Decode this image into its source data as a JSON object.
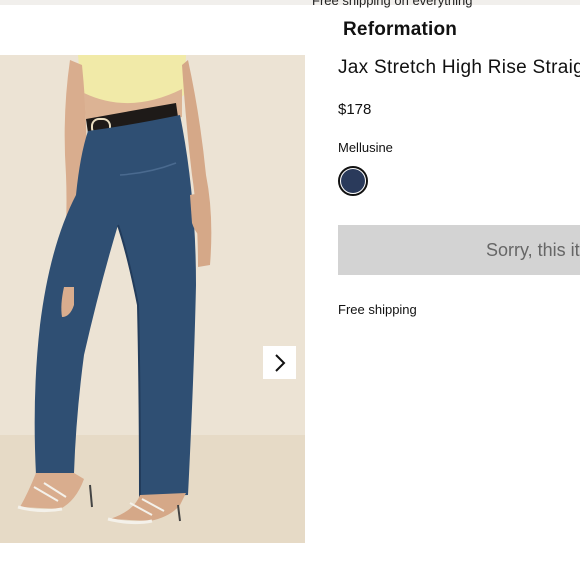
{
  "header": {
    "top_peek_text": "Free shipping on everything",
    "brand": "Reformation"
  },
  "gallery": {
    "image_alt": "Model wearing Jax Stretch High Rise Straight jeans",
    "next_icon": "chevron-right-icon"
  },
  "product": {
    "title": "Jax Stretch High Rise Straight Jeans",
    "price": "$178",
    "color_name": "Mellusine",
    "swatch_color": "#2a3a5b",
    "add_button_label": "Sorry, this item is sold out",
    "shipping_note": "Free shipping"
  },
  "colors": {
    "background": "#ffffff",
    "image_background": "#ebe2d3",
    "disabled_button": "#d3d3d3",
    "denim": "#2f4f73"
  }
}
